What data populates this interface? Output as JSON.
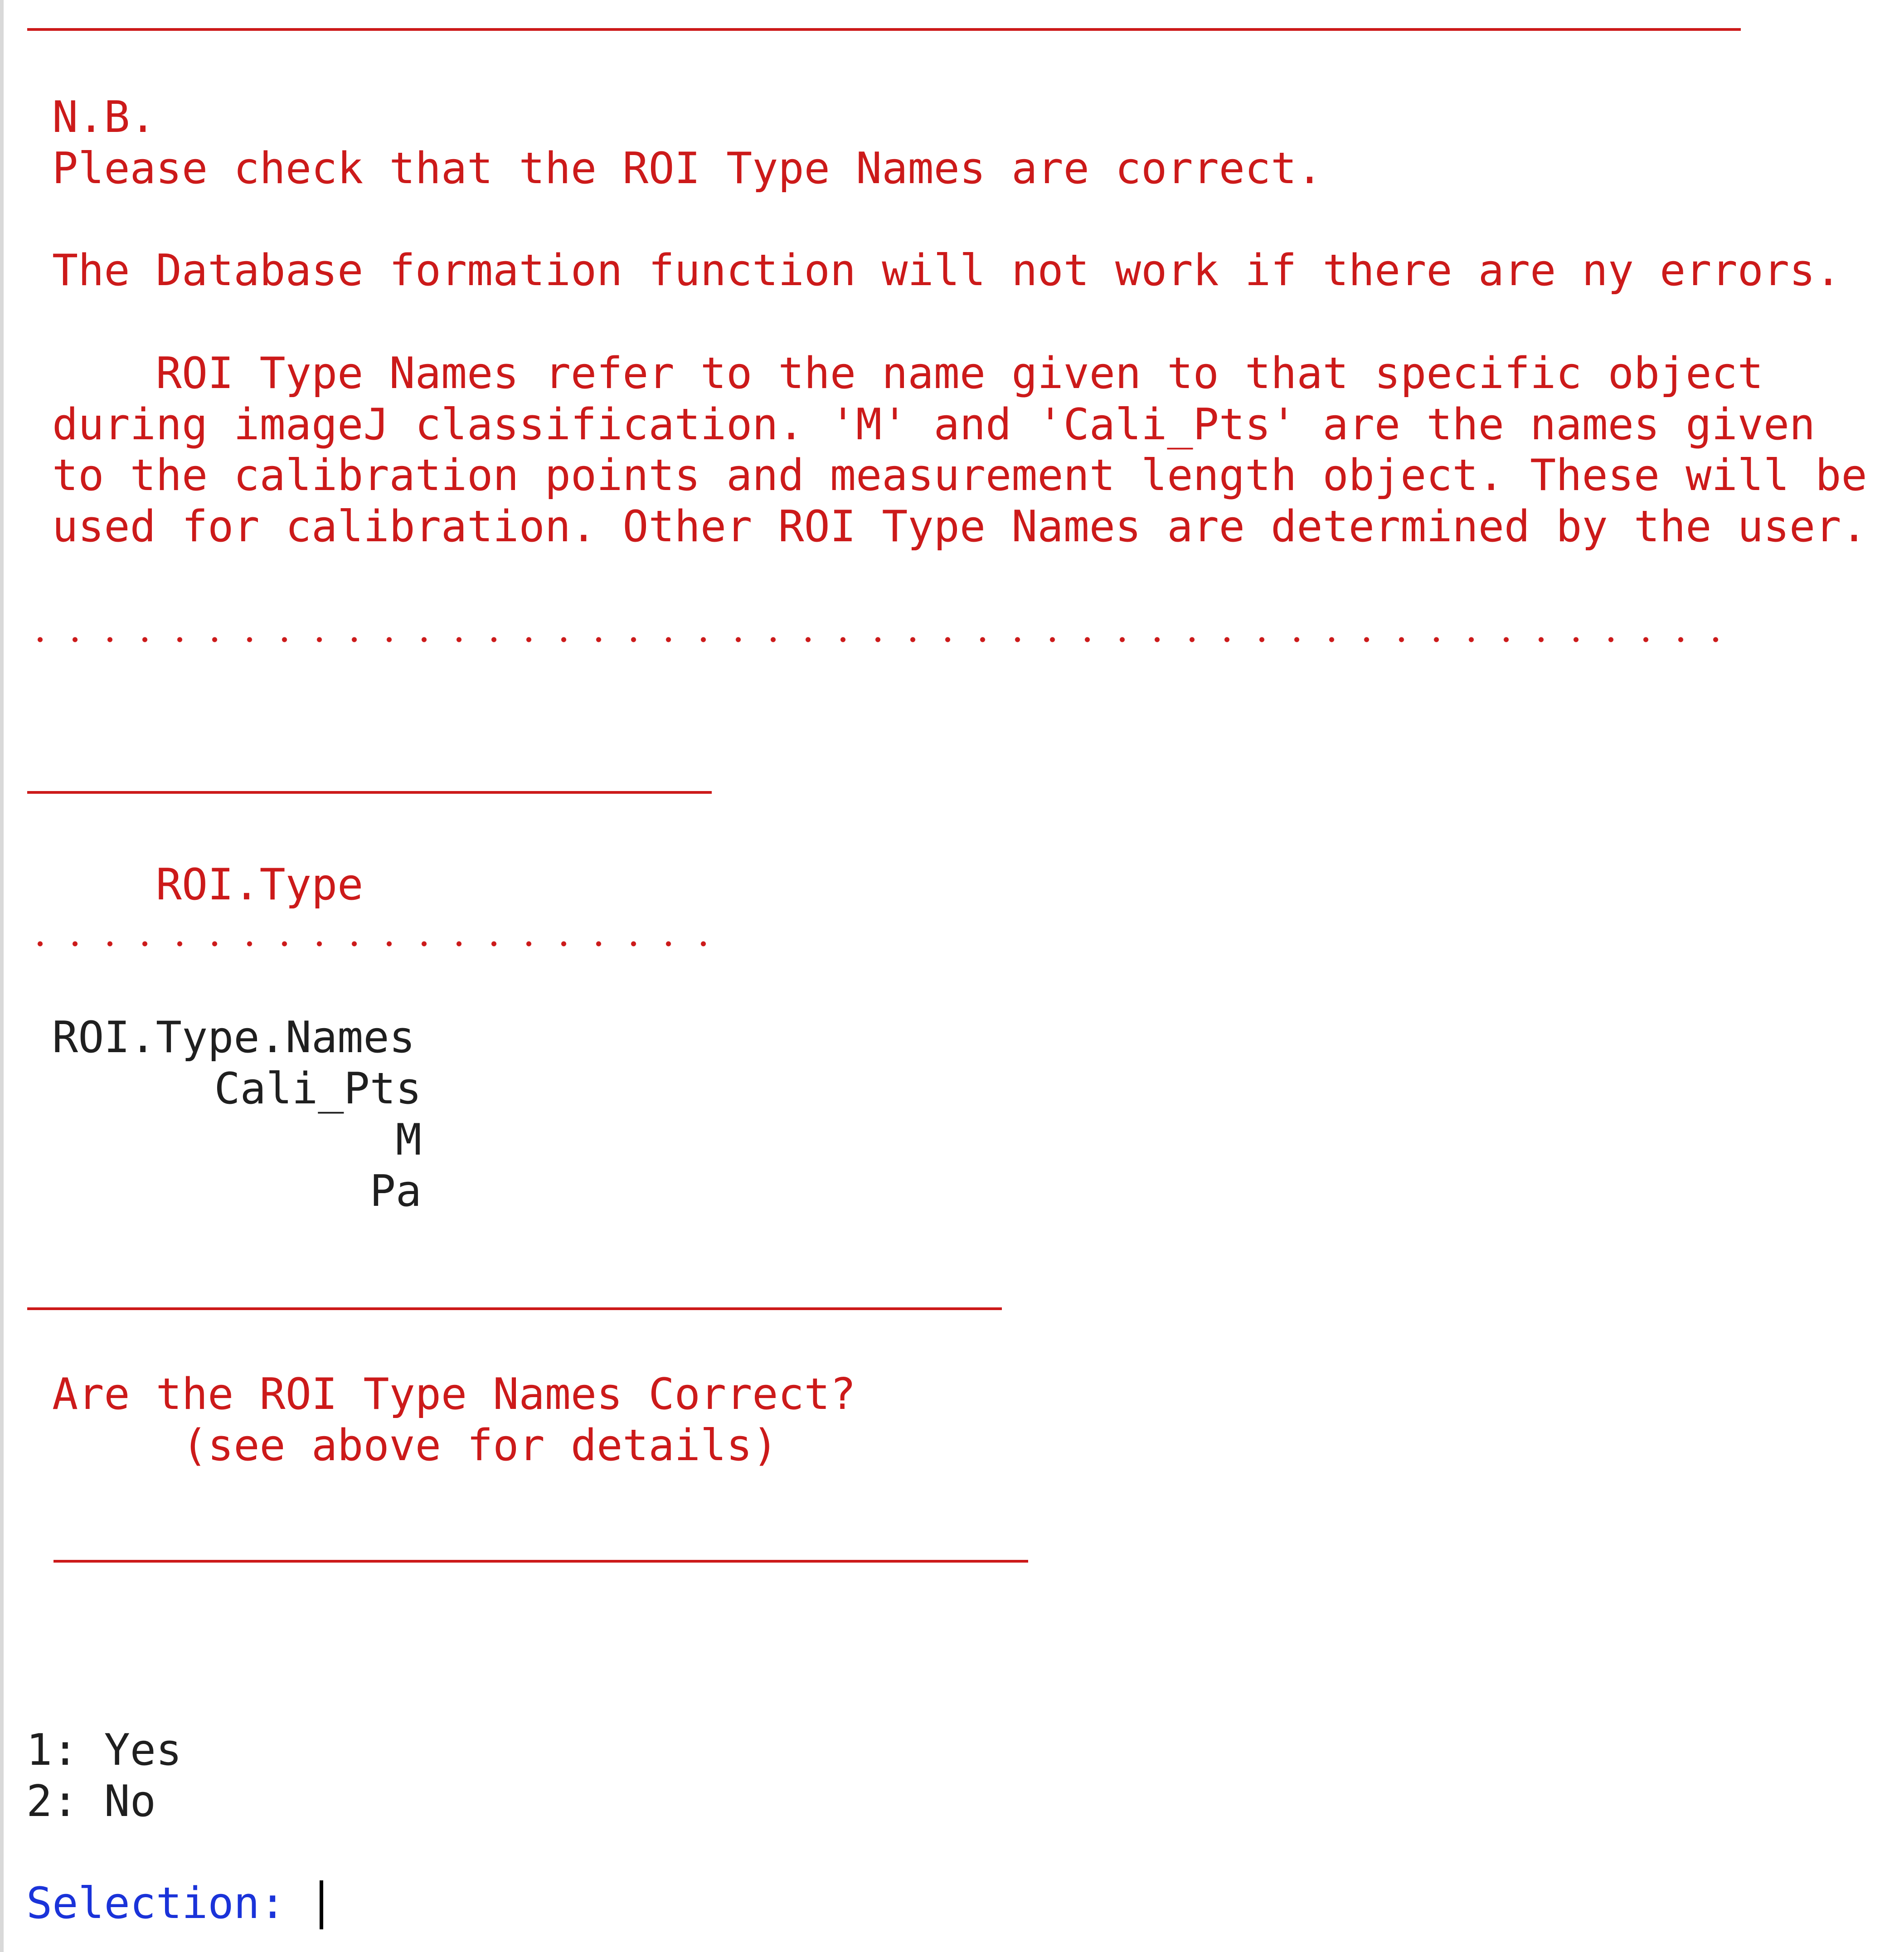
{
  "console": {
    "note_header": "N.B.",
    "note_line": "Please check that the ROI Type Names are correct.",
    "warning_line": "The Database formation function will not work if there are ny errors.",
    "explanation_lines": [
      "    ROI Type Names refer to the name given to that specific object",
      "during imageJ classification. 'M' and 'Cali_Pts' are the names given",
      "to the calibration points and measurement length object. These will be",
      "used for calibration. Other ROI Type Names are determined by the user."
    ],
    "section_title": "    ROI.Type",
    "table_header": "ROI.Type.Names",
    "table_rows": [
      "Cali_Pts",
      "M",
      "Pa"
    ],
    "question_line": "Are the ROI Type Names Correct?",
    "question_hint": "     (see above for details)",
    "options": [
      "1: Yes",
      "2: No"
    ],
    "prompt": "Selection: "
  },
  "colors": {
    "message": "#cc1a1a",
    "output": "#1f1f1f",
    "prompt": "#1a33d9"
  }
}
